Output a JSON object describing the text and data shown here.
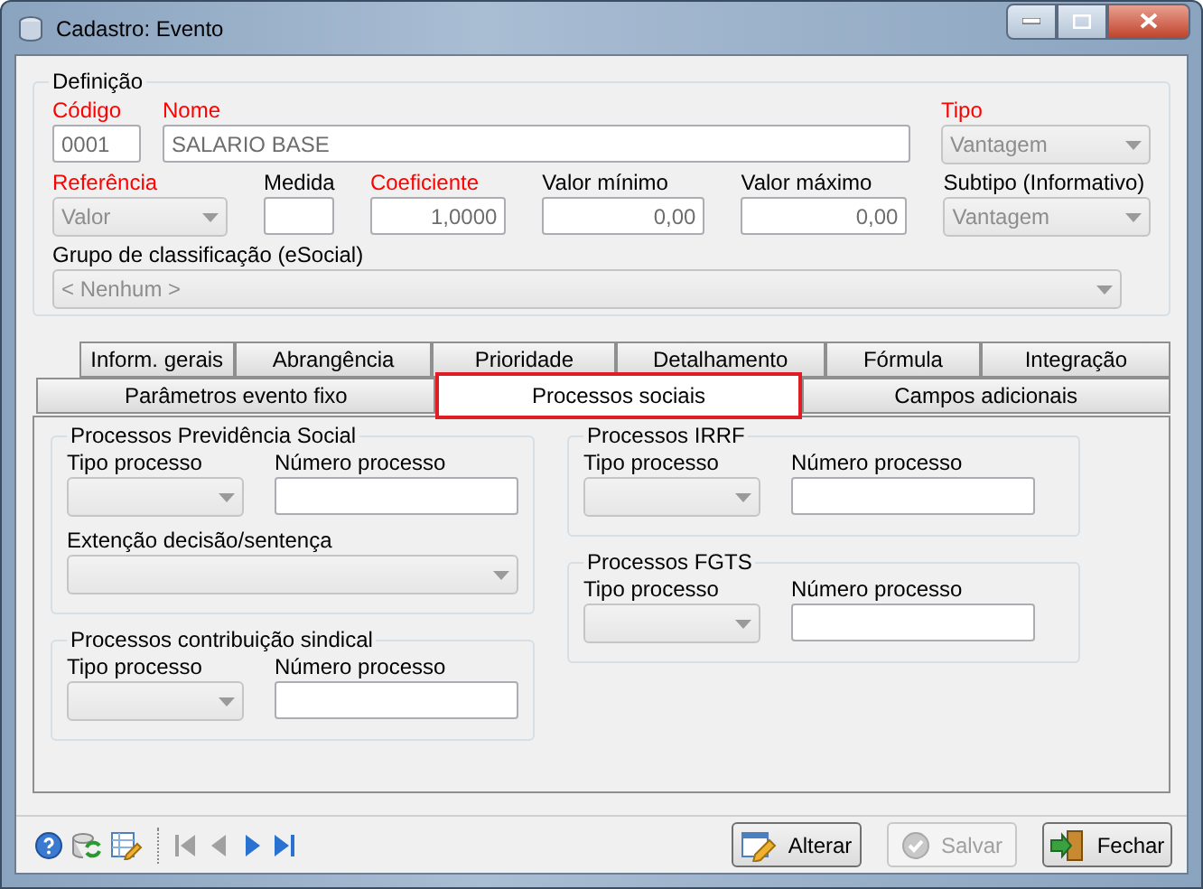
{
  "window": {
    "title": "Cadastro: Evento"
  },
  "definition": {
    "title": "Definição",
    "fields": [
      {
        "label": "Código",
        "required": true,
        "kind": "text",
        "value": "0001"
      },
      {
        "label": "Nome",
        "required": true,
        "kind": "text",
        "value": "SALARIO BASE"
      },
      {
        "label": "Tipo",
        "required": true,
        "kind": "select",
        "value": "Vantagem"
      },
      {
        "label": "Referência",
        "required": true,
        "kind": "select",
        "value": "Valor"
      },
      {
        "label": "Medida",
        "required": false,
        "kind": "text"
      },
      {
        "label": "Coeficiente",
        "required": true,
        "kind": "number",
        "value": "1,0000"
      },
      {
        "label": "Valor mínimo",
        "required": false,
        "kind": "number",
        "value": "0,00"
      },
      {
        "label": "Valor máximo",
        "required": false,
        "kind": "number",
        "value": "0,00"
      },
      {
        "label": "Subtipo (Informativo)",
        "required": false,
        "kind": "select",
        "value": "Vantagem"
      },
      {
        "label": "Grupo de classificação (eSocial)",
        "required": false,
        "kind": "select",
        "value": "< Nenhum >"
      }
    ]
  },
  "tabs": [
    [
      {
        "label": "Inform. gerais",
        "selected": false
      },
      {
        "label": "Abrangência",
        "selected": false
      },
      {
        "label": "Prioridade",
        "selected": false
      },
      {
        "label": "Detalhamento",
        "selected": false
      },
      {
        "label": "Fórmula",
        "selected": false
      },
      {
        "label": "Integração",
        "selected": false
      }
    ],
    [
      {
        "label": "Parâmetros evento fixo",
        "selected": false
      },
      {
        "label": "Processos sociais",
        "selected": true
      },
      {
        "label": "Campos adicionais",
        "selected": false
      }
    ]
  ],
  "panel": {
    "columns": [
      [
        {
          "title": "Processos Previdência Social",
          "rows": [
            [
              {
                "label": "Tipo processo",
                "kind": "select"
              },
              {
                "label": "Número processo",
                "kind": "text"
              }
            ],
            [
              {
                "label": "Extenção decisão/sentença",
                "kind": "select"
              }
            ]
          ]
        },
        {
          "title": "Processos contribuição sindical",
          "rows": [
            [
              {
                "label": "Tipo processo",
                "kind": "select"
              },
              {
                "label": "Número processo",
                "kind": "text"
              }
            ]
          ]
        }
      ],
      [
        {
          "title": "Processos IRRF",
          "rows": [
            [
              {
                "label": "Tipo processo",
                "kind": "select"
              },
              {
                "label": "Número processo",
                "kind": "text"
              }
            ]
          ]
        },
        {
          "title": "Processos FGTS",
          "rows": [
            [
              {
                "label": "Tipo processo",
                "kind": "select"
              },
              {
                "label": "Número processo",
                "kind": "text"
              }
            ]
          ]
        }
      ]
    ]
  },
  "footer": {
    "buttons": [
      {
        "label": "Alterar",
        "kind": "edit",
        "disabled": false
      },
      {
        "label": "Salvar",
        "kind": "save",
        "disabled": true
      },
      {
        "label": "Fechar",
        "kind": "exit",
        "disabled": false
      }
    ]
  }
}
